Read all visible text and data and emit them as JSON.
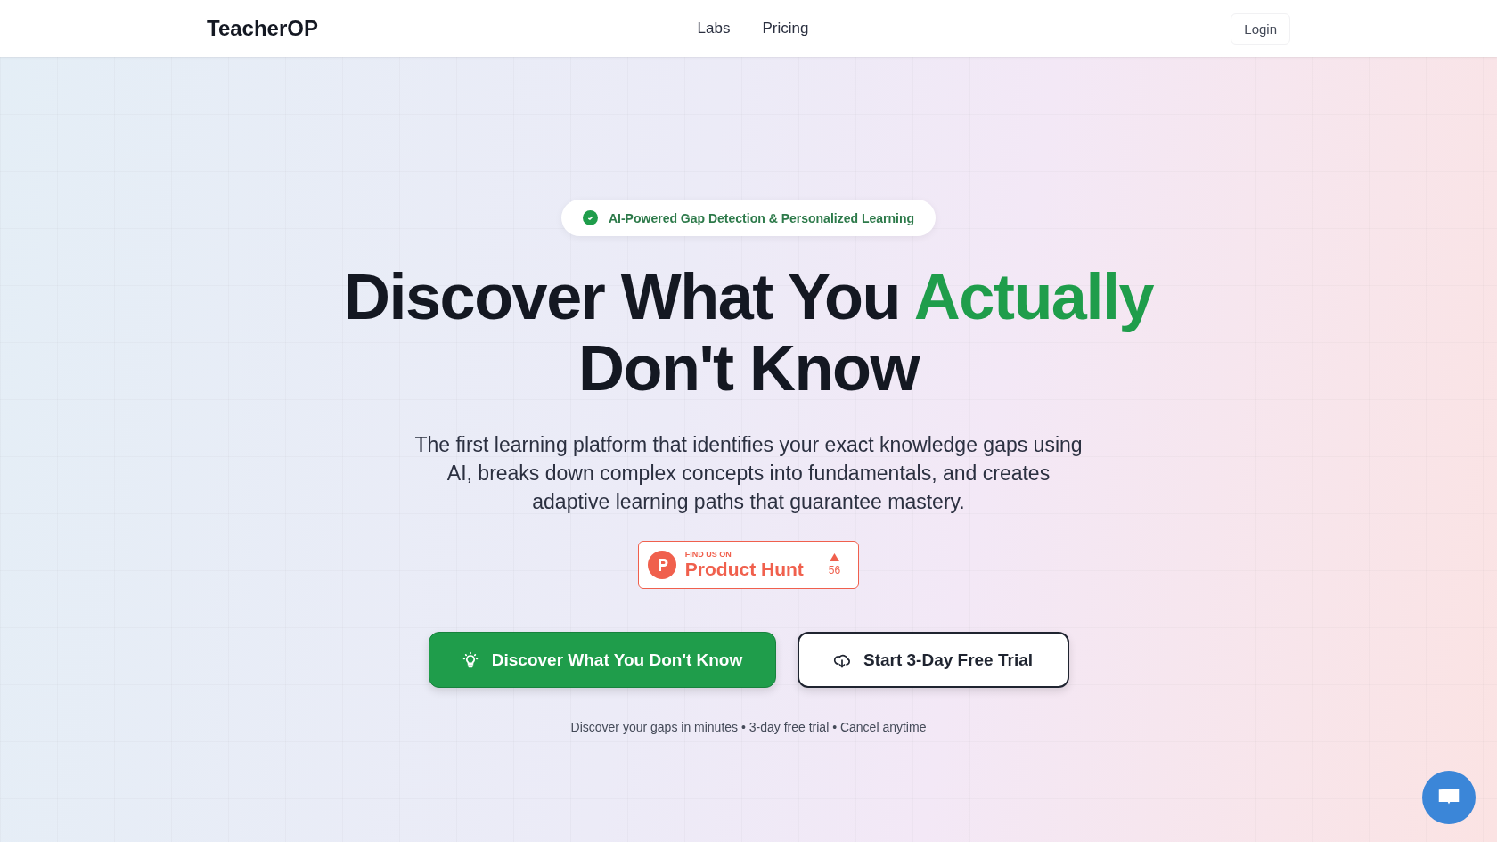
{
  "header": {
    "logo": "TeacherOP",
    "nav": [
      {
        "label": "Labs"
      },
      {
        "label": "Pricing"
      }
    ],
    "login": "Login"
  },
  "hero": {
    "badge": "AI-Powered Gap Detection & Personalized Learning",
    "headline": [
      [
        {
          "text": "Discover What You ",
          "highlight": false
        },
        {
          "text": "Actually",
          "highlight": true
        }
      ],
      [
        {
          "text": "Don't Know",
          "highlight": false
        }
      ]
    ],
    "description": "The first learning platform that identifies your exact knowledge gaps using AI, breaks down complex concepts into fundamentals, and creates adaptive learning paths that guarantee mastery.",
    "product_hunt": {
      "kicker": "FIND US ON",
      "name": "Product Hunt",
      "votes": "56"
    },
    "buttons": [
      {
        "kind": "primary",
        "label": "Discover What You Don't Know"
      },
      {
        "kind": "secondary",
        "label": "Start 3-Day Free Trial"
      }
    ],
    "footnote": "Discover your gaps in minutes • 3-day free trial • Cancel anytime"
  }
}
